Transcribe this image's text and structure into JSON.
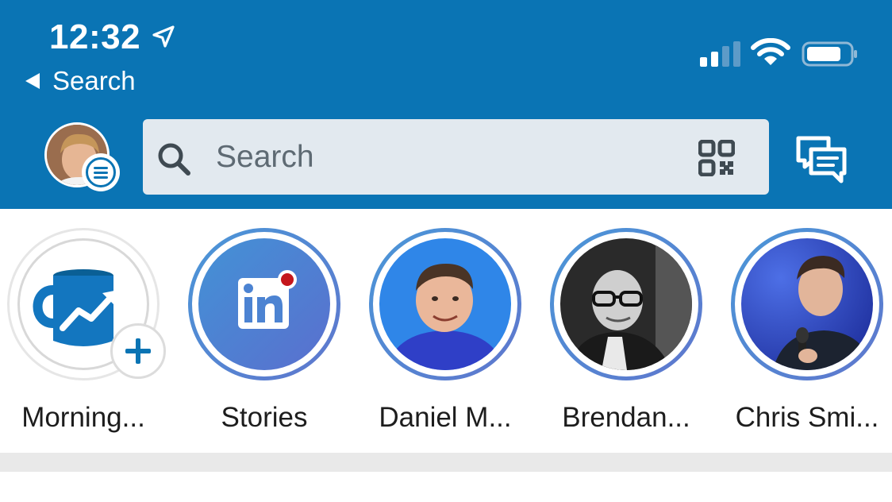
{
  "status_bar": {
    "time": "12:32",
    "back_label": "Search"
  },
  "header": {
    "search_placeholder": "Search",
    "avatar_icon": "profile-avatar",
    "menu_icon": "menu-lines-icon",
    "qr_icon": "qr-code-icon",
    "messages_icon": "messaging-icon",
    "accent_color": "#0a74b4"
  },
  "stories": [
    {
      "label": "Morning...",
      "kind": "add",
      "icon": "coffee-mug-chart-icon"
    },
    {
      "label": "Stories",
      "kind": "logo",
      "icon": "linkedin-logo-icon"
    },
    {
      "label": "Daniel M...",
      "kind": "person"
    },
    {
      "label": "Brendan...",
      "kind": "person"
    },
    {
      "label": "Chris Smi...",
      "kind": "person"
    }
  ]
}
